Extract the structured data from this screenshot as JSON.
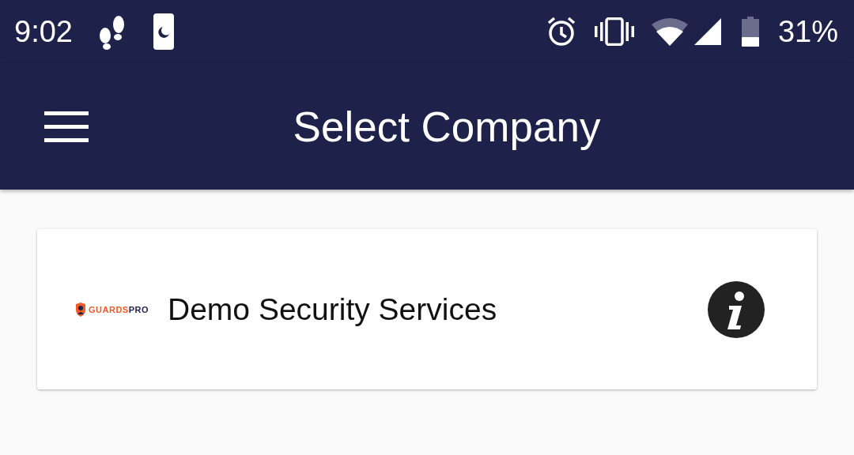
{
  "status_bar": {
    "time": "9:02",
    "battery": "31%"
  },
  "app_bar": {
    "title": "Select Company"
  },
  "companies": [
    {
      "logo_primary": "GUARDS",
      "logo_secondary": "PRO",
      "name": "Demo Security Services"
    }
  ]
}
